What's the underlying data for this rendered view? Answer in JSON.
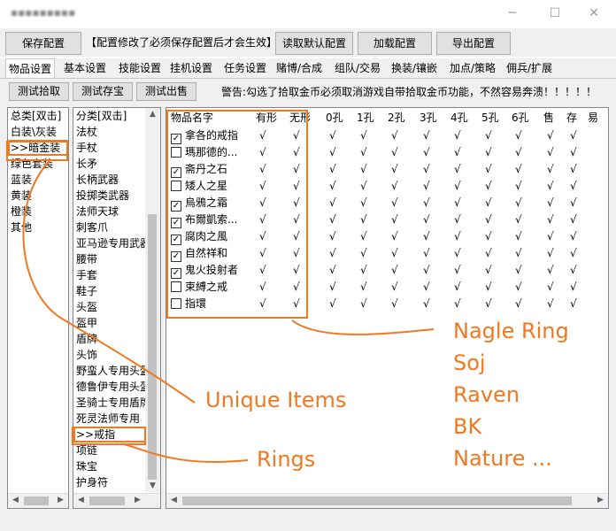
{
  "window": {
    "title": "▪▪▪▪▪▪▪▪▪"
  },
  "toolbar": {
    "save_label": "保存配置",
    "notice": "【配置修改了必须保存配置后才会生效】",
    "load_default_label": "读取默认配置",
    "load_label": "加载配置",
    "export_label": "导出配置"
  },
  "tabs": [
    "物品设置",
    "基本设置",
    "技能设置",
    "挂机设置",
    "任务设置",
    "赌博/合成",
    "组队/交易",
    "换装/镶嵌",
    "加点/策略",
    "佣兵/扩展"
  ],
  "actions": {
    "test_pickup": "测试拾取",
    "test_stash": "测试存宝",
    "test_sell": "测试出售",
    "warning": "警告:勾选了拾取金币必须取消游戏自带拾取金币功能，不然容易奔溃！！！！！"
  },
  "category_total": {
    "header": "总类[双击]",
    "items": [
      "白装\\灰装",
      ">>暗金装",
      "绿色套装",
      "蓝装",
      "黄装",
      "橙装",
      "其他"
    ],
    "selected_index": 1
  },
  "category_sub": {
    "header": "分类[双击]",
    "items": [
      "法杖",
      "手杖",
      "长矛",
      "长柄武器",
      "投掷类武器",
      "法师天球",
      "刺客爪",
      "亚马逊专用武器",
      "腰带",
      "手套",
      "鞋子",
      "头盔",
      "盔甲",
      "盾牌",
      "头饰",
      "野蛮人专用头盔",
      "德鲁伊专用头盔",
      "圣骑士专用盾牌",
      "死灵法师专用",
      ">>戒指",
      "项链",
      "珠宝",
      "护身符"
    ],
    "selected_index": 19
  },
  "grid": {
    "columns": [
      "物品名字",
      "有形",
      "无形",
      "0孔",
      "1孔",
      "2孔",
      "3孔",
      "4孔",
      "5孔",
      "6孔",
      "售",
      "存",
      "易"
    ],
    "check_mark": "√",
    "rows": [
      {
        "name": "拿各的戒指",
        "checked": true
      },
      {
        "name": "瑪那德的...",
        "checked": false
      },
      {
        "name": "斋丹之石",
        "checked": true
      },
      {
        "name": "矮人之星",
        "checked": false
      },
      {
        "name": "烏鴉之霜",
        "checked": true
      },
      {
        "name": "布爾凱索...",
        "checked": true
      },
      {
        "name": "腐肉之風",
        "checked": true
      },
      {
        "name": "自然祥和",
        "checked": true
      },
      {
        "name": "鬼火投射者",
        "checked": true
      },
      {
        "name": "束縛之戒",
        "checked": false
      },
      {
        "name": "指環",
        "checked": false
      }
    ]
  },
  "annotations": {
    "unique_items": "Unique Items",
    "rings": "Rings",
    "list": [
      "Nagle Ring",
      "Soj",
      "Raven",
      "BK",
      "Nature ..."
    ],
    "color": "#f07820"
  }
}
